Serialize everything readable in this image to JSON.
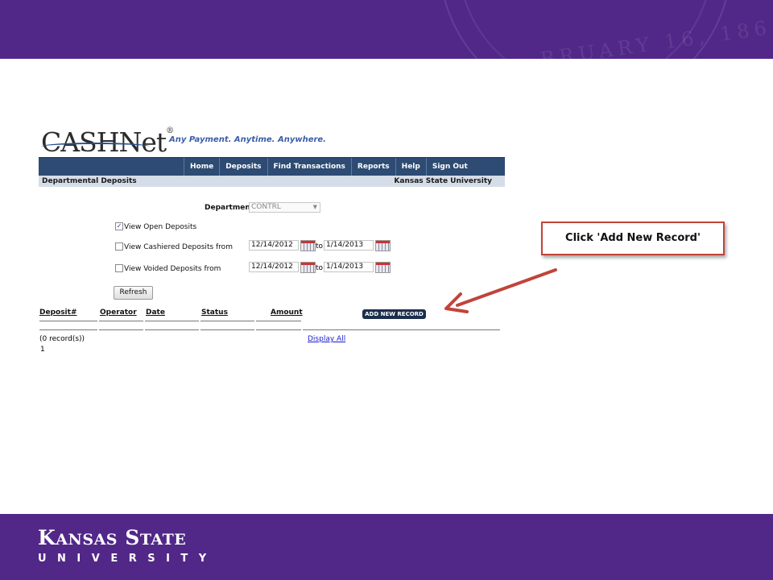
{
  "slide": {
    "seal_text": "BRUARY 16, 186",
    "footer_logo": {
      "line1_initial_k": "K",
      "line1_rest_k": "ANSAS",
      "line1_initial_s": "S",
      "line1_rest_s": "TATE",
      "line2": "UNIVERSITY"
    },
    "colors": {
      "brand_purple": "#512888",
      "callout_border": "#c0443a",
      "arrow": "#c0443a"
    }
  },
  "app": {
    "brand": "CASHNet",
    "brand_mark": "®",
    "tagline": "Any Payment. Anytime. Anywhere.",
    "menu": [
      "Home",
      "Deposits",
      "Find Transactions",
      "Reports",
      "Help",
      "Sign Out"
    ],
    "page_title": "Departmental Deposits",
    "institution": "Kansas State University",
    "department_label": "Department",
    "department_value": "CONTRL",
    "filters": {
      "open_label": "View Open Deposits",
      "open_checked": true,
      "cashiered_label": "View Cashiered Deposits from",
      "cashiered_checked": false,
      "cashiered_from": "12/14/2012",
      "cashiered_to": "1/14/2013",
      "voided_label": "View Voided Deposits from",
      "voided_checked": false,
      "voided_from": "12/14/2012",
      "voided_to": "1/14/2013",
      "to_label": "to"
    },
    "refresh_label": "Refresh",
    "columns": [
      "Deposit#",
      "Operator",
      "Date",
      "Status",
      "Amount"
    ],
    "add_new_label": "ADD NEW RECORD",
    "records_text": "(0 record(s))",
    "page_number": "1",
    "display_all": "Display All"
  },
  "callout": {
    "text": "Click 'Add New Record'"
  }
}
